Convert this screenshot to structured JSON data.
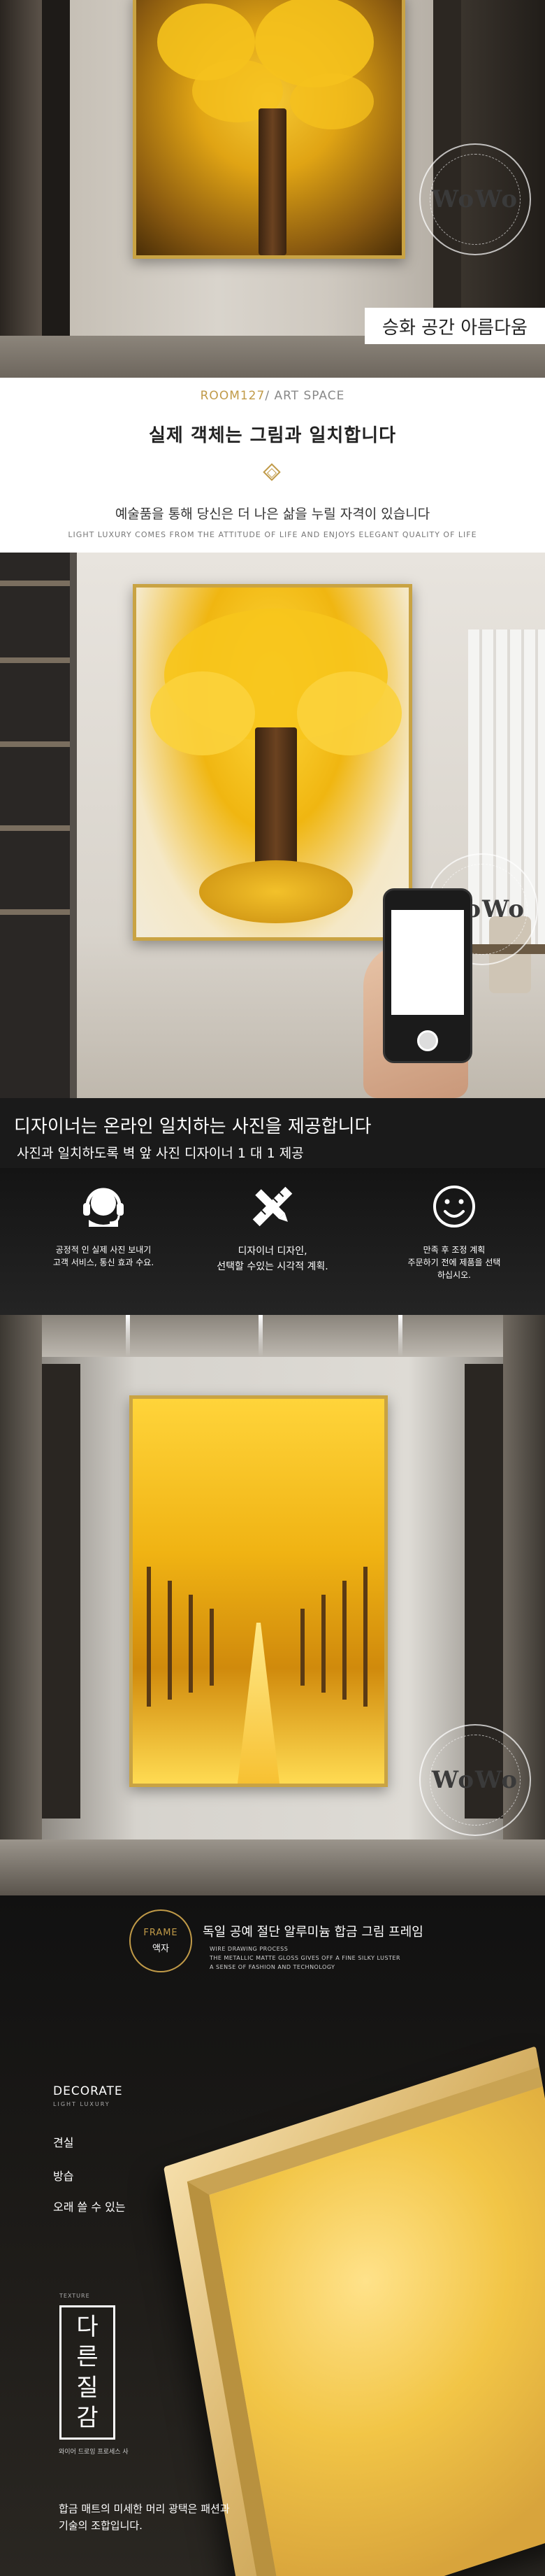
{
  "hero": {
    "caption": "승화 공간 아름다움",
    "watermark": "WoWo"
  },
  "intro": {
    "eyebrow_prefix": "ROOM127",
    "eyebrow_suffix": "/ ART SPACE",
    "headline": "실제 객체는 그림과 일치합니다",
    "subheadline": "예술품을 통해 당신은 더 나은 삶을 누릴 자격이 있습니다",
    "tagline": "LIGHT LUXURY COMES FROM THE ATTITUDE OF LIFE AND ENJOYS ELEGANT QUALITY OF LIFE"
  },
  "showcase": {
    "watermark": "WoWo"
  },
  "service": {
    "headline": "디자이너는 온라인 일치하는 사진을 제공합니다",
    "subline": "사진과 일치하도록 벽 앞 사진 디자이너 1 대 1 제공",
    "features": [
      {
        "icon": "headset-icon",
        "text": "공정적 인 실제 사진 보내기\n고객 서비스, 통신 효과 수요."
      },
      {
        "icon": "pencil-ruler-icon",
        "text": "디자이너 디자인,\n선택할 수있는 시각적 계획."
      },
      {
        "icon": "smile-icon",
        "text": "만족 후 조정 계획\n주문하기 전에 제품을 선택\n하십시오."
      }
    ]
  },
  "avenue": {
    "watermark": "WoWo"
  },
  "frame": {
    "badge_en": "FRAME",
    "badge_ko": "액자",
    "title": "독일 공예 절단 알루미늄 합금 그림 프레임",
    "small_text": "WIRE DRAWING PROCESS\nTHE METALLIC MATTE GLOSS GIVES OFF A FINE SILKY LUSTER\nA SENSE OF FASHION AND TECHNOLOGY",
    "decorate": "DECORATE",
    "decorate_sub": "LIGHT LUXURY",
    "items": [
      "견실",
      "방습",
      "오래 쓸 수 있는"
    ],
    "texture_label": "TEXTURE",
    "texture_chars": [
      "다",
      "른",
      "질",
      "감"
    ],
    "texture_note": "와이어 드로잉 프로세스 사",
    "bottom_text": "합금 매트의 미세한 머리 광택은 패션과\n기술의 조합입니다."
  },
  "colors": {
    "gold": "#c9a343",
    "accent": "#c09a48",
    "dark": "#1a1a1a"
  }
}
